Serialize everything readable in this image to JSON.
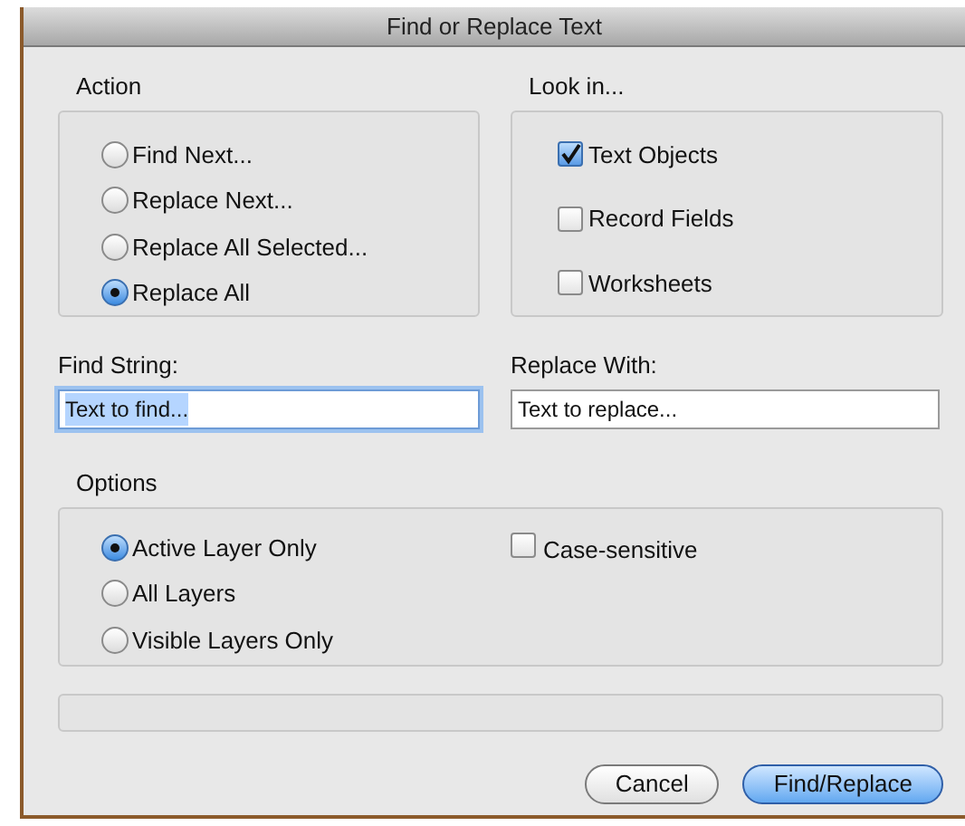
{
  "window": {
    "title": "Find or Replace Text"
  },
  "action": {
    "label": "Action",
    "options": [
      {
        "label": "Find Next...",
        "selected": false
      },
      {
        "label": "Replace Next...",
        "selected": false
      },
      {
        "label": "Replace All Selected...",
        "selected": false
      },
      {
        "label": "Replace All",
        "selected": true
      }
    ]
  },
  "look_in": {
    "label": "Look in...",
    "options": [
      {
        "label": "Text Objects",
        "checked": true
      },
      {
        "label": "Record Fields",
        "checked": false
      },
      {
        "label": "Worksheets",
        "checked": false
      }
    ]
  },
  "find_string": {
    "label": "Find String:",
    "value": "Text to find...",
    "focused": true
  },
  "replace_with": {
    "label": "Replace With:",
    "value": "Text to replace...",
    "focused": false
  },
  "options": {
    "label": "Options",
    "layers": [
      {
        "label": "Active Layer Only",
        "selected": true
      },
      {
        "label": "All Layers",
        "selected": false
      },
      {
        "label": "Visible Layers Only",
        "selected": false
      }
    ],
    "case_sensitive": {
      "label": "Case-sensitive",
      "checked": false
    }
  },
  "buttons": [
    {
      "label": "Cancel",
      "default": false
    },
    {
      "label": "Find/Replace",
      "default": true
    }
  ]
}
